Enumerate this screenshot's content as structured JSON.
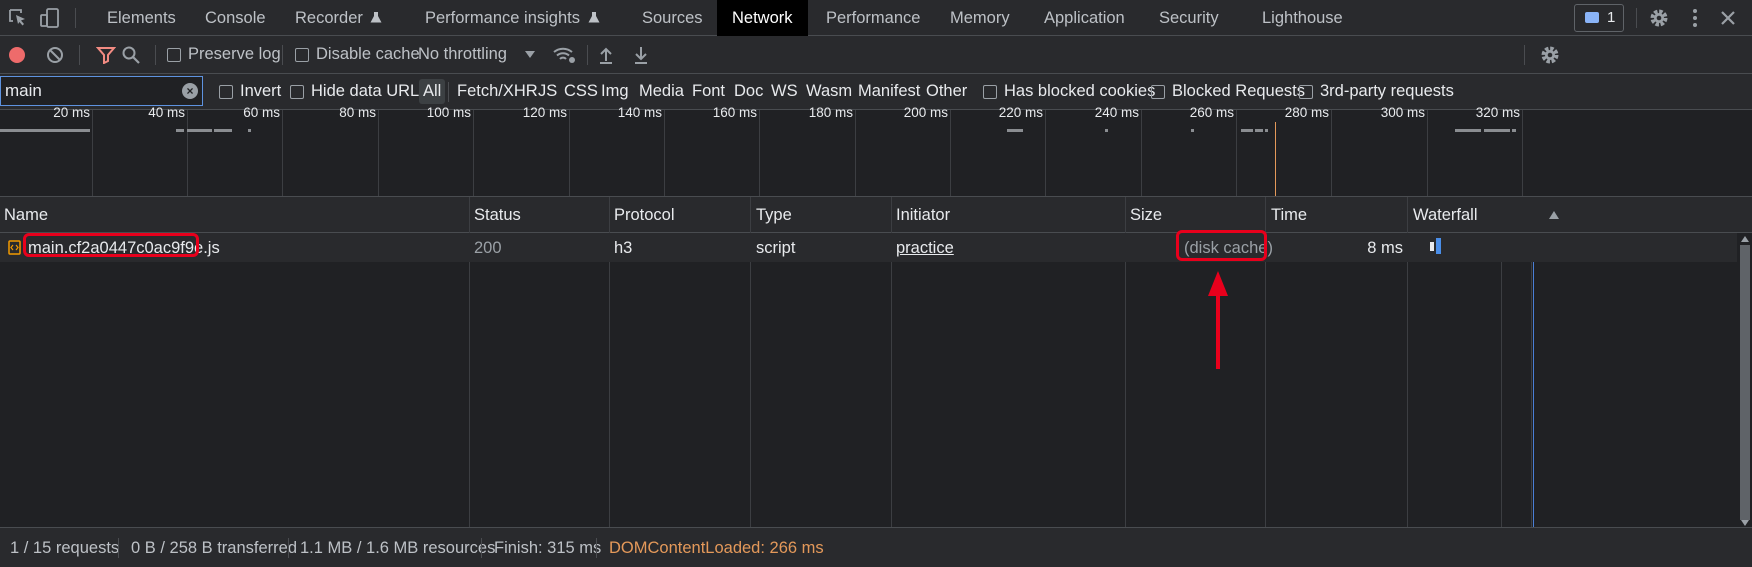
{
  "tabs": [
    {
      "label": "Elements"
    },
    {
      "label": "Console"
    },
    {
      "label": "Recorder"
    },
    {
      "label": "Performance insights"
    },
    {
      "label": "Sources"
    },
    {
      "label": "Network",
      "active": true
    },
    {
      "label": "Performance"
    },
    {
      "label": "Memory"
    },
    {
      "label": "Application"
    },
    {
      "label": "Security"
    },
    {
      "label": "Lighthouse"
    }
  ],
  "issues_badge": "1",
  "toolbar": {
    "preserve_log": "Preserve log",
    "disable_cache": "Disable cache",
    "throttling": "No throttling"
  },
  "filter": {
    "value": "main",
    "invert": "Invert",
    "hide_data_urls": "Hide data URLs",
    "types": [
      "All",
      "Fetch/XHR",
      "JS",
      "CSS",
      "Img",
      "Media",
      "Font",
      "Doc",
      "WS",
      "Wasm",
      "Manifest",
      "Other"
    ],
    "active_type": "All",
    "blocked_cookies": "Has blocked cookies",
    "blocked_requests": "Blocked Requests",
    "third_party": "3rd-party requests"
  },
  "overview_ticks": [
    "20 ms",
    "40 ms",
    "60 ms",
    "80 ms",
    "100 ms",
    "120 ms",
    "140 ms",
    "160 ms",
    "180 ms",
    "200 ms",
    "220 ms",
    "240 ms",
    "260 ms",
    "280 ms",
    "300 ms",
    "320 ms"
  ],
  "table": {
    "columns": [
      "Name",
      "Status",
      "Protocol",
      "Type",
      "Initiator",
      "Size",
      "Time",
      "Waterfall"
    ],
    "rows": [
      {
        "name": "main.cf2a0447c0ac9f9e.js",
        "status": "200",
        "protocol": "h3",
        "type": "script",
        "initiator": "practice",
        "size": "(disk cache)",
        "time": "8 ms"
      }
    ]
  },
  "status": {
    "requests": "1 / 15 requests",
    "transferred": "0 B / 258 B transferred",
    "resources": "1.1 MB / 1.6 MB resources",
    "finish": "Finish: 315 ms",
    "dom_content_loaded": "DOMContentLoaded: 266 ms"
  },
  "colors": {
    "highlight": "#e8001c",
    "dom_content_loaded": "#e4995a",
    "accent": "#8ab4f8"
  }
}
